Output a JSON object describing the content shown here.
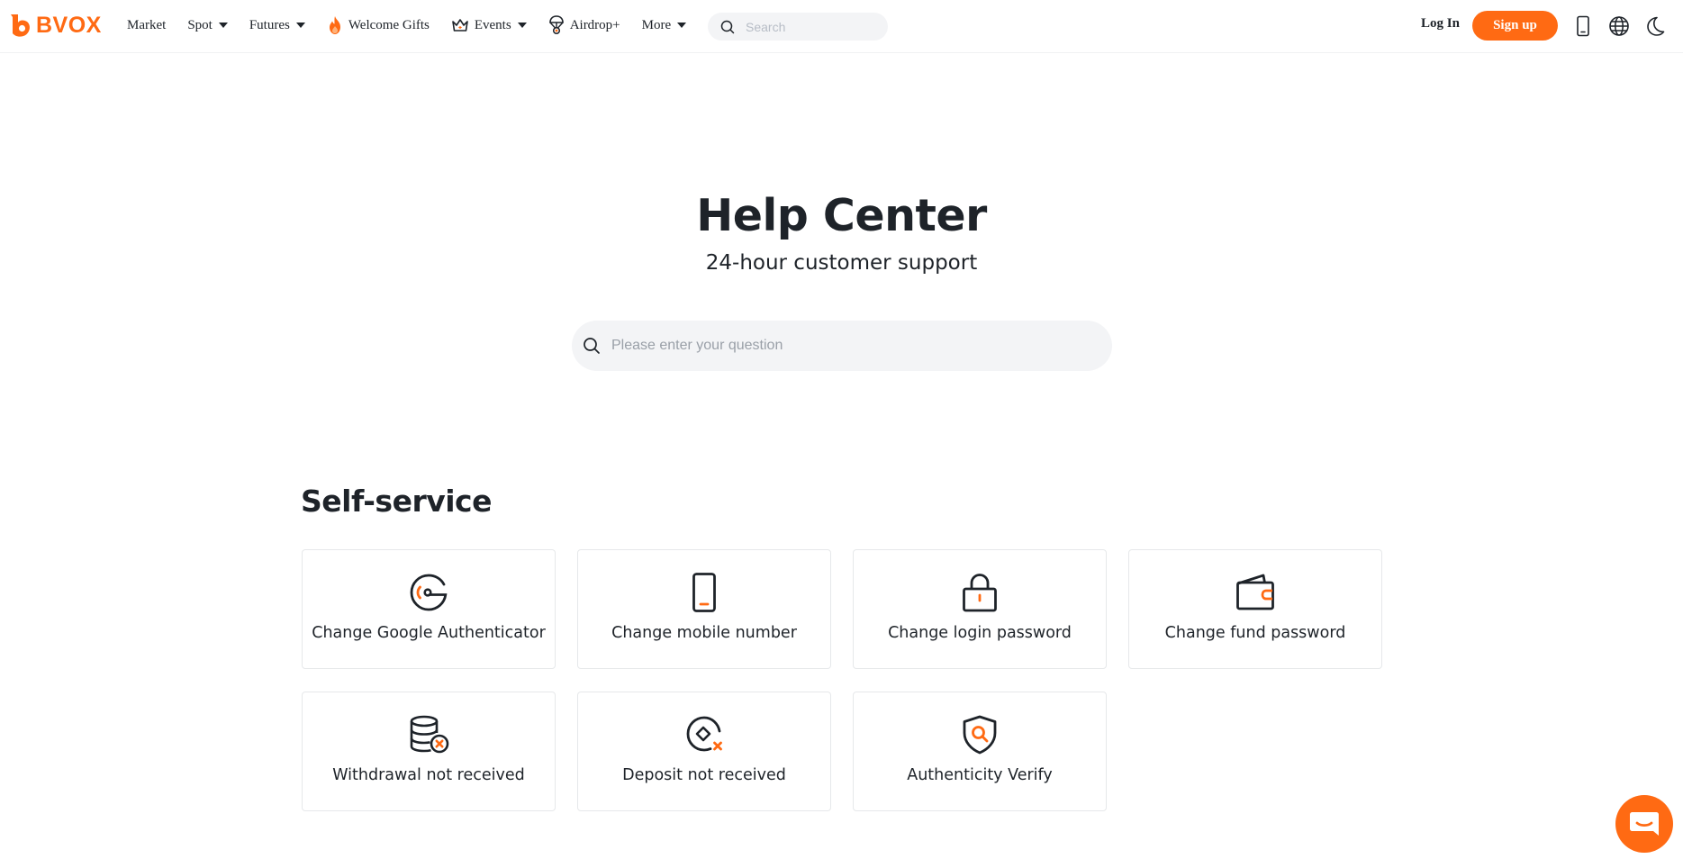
{
  "brand": {
    "name": "BVOX",
    "accent": "#ff6a13"
  },
  "nav": {
    "market": "Market",
    "spot": "Spot",
    "futures": "Futures",
    "welcome_gifts": "Welcome Gifts",
    "events": "Events",
    "airdrop": "Airdrop+",
    "more": "More"
  },
  "search": {
    "placeholder": "Search"
  },
  "auth": {
    "login": "Log In",
    "signup": "Sign up"
  },
  "header_icons": [
    "mobile-icon",
    "globe-icon",
    "moon-icon"
  ],
  "hero": {
    "title": "Help Center",
    "subtitle": "24-hour customer support",
    "search_placeholder": "Please enter your question"
  },
  "self_service": {
    "title": "Self-service",
    "items": [
      {
        "label": "Change Google Authenticator",
        "icon": "google-authenticator-icon"
      },
      {
        "label": "Change mobile number",
        "icon": "mobile-phone-icon"
      },
      {
        "label": "Change login password",
        "icon": "lock-icon"
      },
      {
        "label": "Change fund password",
        "icon": "wallet-icon"
      },
      {
        "label": "Withdrawal not received",
        "icon": "coins-x-icon"
      },
      {
        "label": "Deposit not received",
        "icon": "deposit-x-icon"
      },
      {
        "label": "Authenticity Verify",
        "icon": "shield-search-icon"
      }
    ]
  },
  "chat": {
    "icon": "chat-icon"
  }
}
